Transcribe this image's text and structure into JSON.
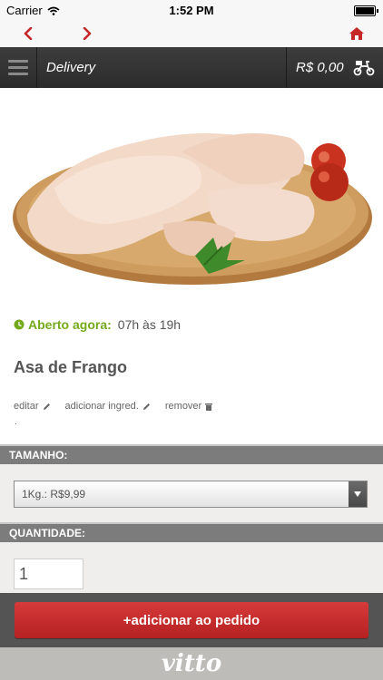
{
  "status_bar": {
    "carrier": "Carrier",
    "time": "1:52 PM"
  },
  "header": {
    "title": "Delivery",
    "cart_total": "R$ 0,00"
  },
  "product": {
    "open_label": "Aberto agora:",
    "hours": "07h às 19h",
    "name": "Asa de Frango",
    "actions": {
      "edit": "editar",
      "add_ingredient": "adicionar ingred.",
      "remove": "remover"
    },
    "note": "."
  },
  "size": {
    "label": "TAMANHO:",
    "selected": "1Kg.: R$9,99"
  },
  "quantity": {
    "label": "QUANTIDADE:",
    "value": "1"
  },
  "add_button": "+adicionar ao pedido",
  "footer": {
    "brand": "vitto"
  },
  "colors": {
    "accent": "#c62828",
    "open_green": "#74a91c",
    "header_bg": "#2f2f2f"
  },
  "icons": [
    "wifi-icon",
    "battery-icon",
    "chevron-left-icon",
    "chevron-right-icon",
    "home-icon",
    "menu-icon",
    "scooter-icon",
    "clock-icon",
    "pencil-icon",
    "trash-icon",
    "dropdown-arrow-icon"
  ]
}
